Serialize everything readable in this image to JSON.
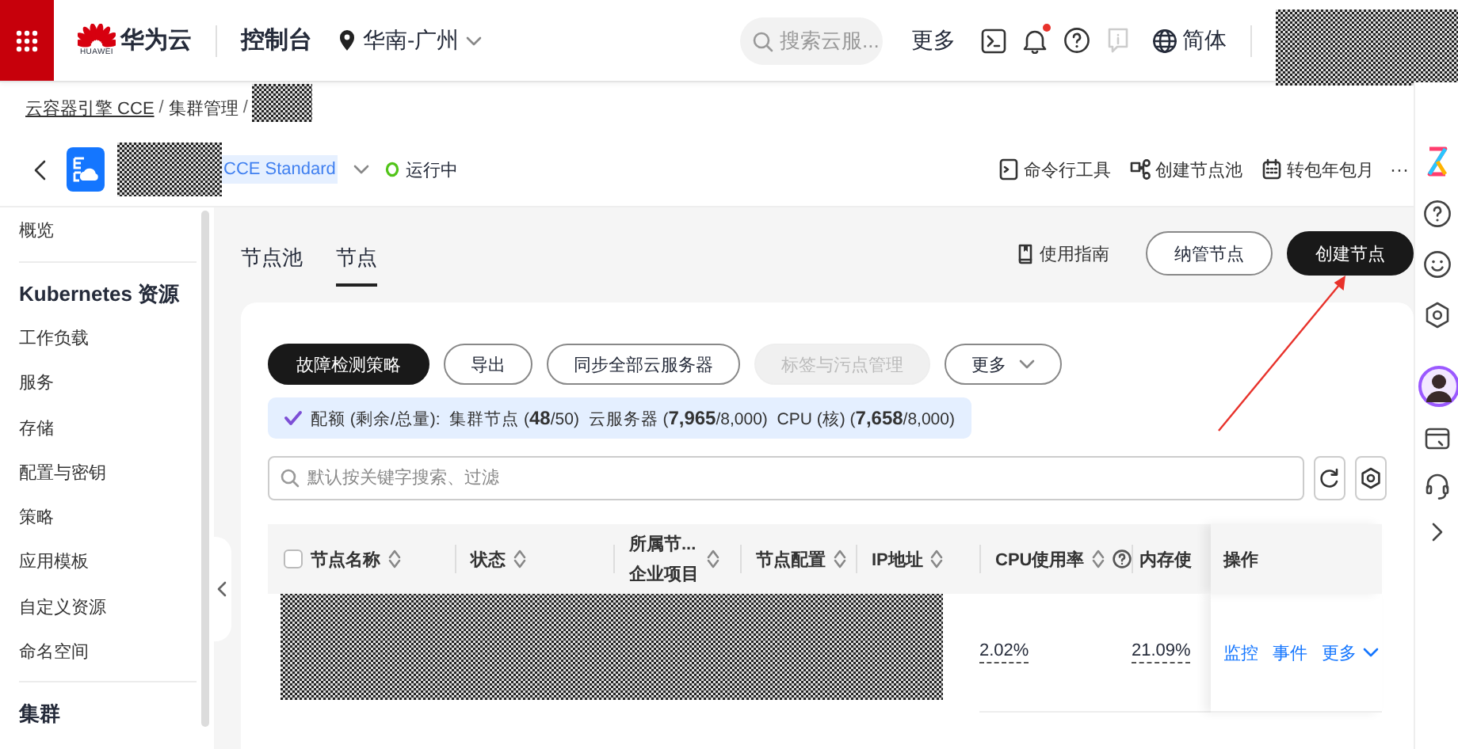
{
  "top_bar": {
    "brand": "华为云",
    "logo_caption": "HUAWEI",
    "console": "控制台",
    "region": "华南-广州",
    "search": {
      "placeholder": "搜索云服..."
    },
    "more": "更多",
    "notification_unread": true,
    "language": "简体"
  },
  "breadcrumb": {
    "separator": "/",
    "items": [
      {
        "label": "云容器引擎 CCE",
        "kind": "link"
      },
      {
        "label": "集群管理",
        "kind": "text"
      }
    ]
  },
  "cluster": {
    "edition": "CCE Standard",
    "status": "运行中"
  },
  "header_actions": [
    {
      "label": "命令行工具"
    },
    {
      "label": "创建节点池"
    },
    {
      "label": "转包年包月"
    }
  ],
  "more_actions": "···",
  "sidebar": {
    "items": [
      {
        "kind": "item",
        "label": "概览",
        "selected": false
      },
      {
        "kind": "divider"
      },
      {
        "kind": "heading",
        "label": "Kubernetes 资源"
      },
      {
        "kind": "item",
        "label": "工作负载",
        "selected": false
      },
      {
        "kind": "item",
        "label": "服务",
        "selected": false
      },
      {
        "kind": "item",
        "label": "存储",
        "selected": false
      },
      {
        "kind": "item",
        "label": "配置与密钥",
        "selected": false
      },
      {
        "kind": "item",
        "label": "策略",
        "selected": false
      },
      {
        "kind": "item",
        "label": "应用模板",
        "selected": false
      },
      {
        "kind": "item",
        "label": "自定义资源",
        "selected": false
      },
      {
        "kind": "item",
        "label": "命名空间",
        "selected": false
      },
      {
        "kind": "divider"
      },
      {
        "kind": "heading",
        "label": "集群"
      }
    ]
  },
  "tabs": [
    {
      "label": "节点池",
      "selected": false
    },
    {
      "label": "节点",
      "selected": true
    }
  ],
  "page_actions": {
    "guide": "使用指南",
    "buttons": [
      {
        "label": "纳管节点",
        "kind": "outline"
      },
      {
        "label": "创建节点",
        "kind": "primary"
      }
    ]
  },
  "toolbar": [
    {
      "label": "故障检测策略",
      "kind": "primary",
      "disabled": false
    },
    {
      "label": "导出",
      "kind": "outline",
      "disabled": false
    },
    {
      "label": "同步全部云服务器",
      "kind": "outline",
      "disabled": false
    },
    {
      "label": "标签与污点管理",
      "kind": "outline",
      "disabled": true
    },
    {
      "label": "更多",
      "kind": "dropdown",
      "disabled": false
    }
  ],
  "quota": "配额 (剩余/总量):  集群节点 (**48**/50)  云服务器 (**7,965**/8,000)  CPU (核) (**7,658**/8,000)",
  "filter": {
    "placeholder": "默认按关键字搜索、过滤"
  },
  "table": {
    "all_checked": false,
    "columns": [
      {
        "label": "节点名称",
        "sortable": true,
        "help": false
      },
      {
        "label": "状态",
        "sortable": true,
        "help": false
      },
      {
        "label": "所属节...",
        "sublabel": "企业项目",
        "sortable": true,
        "help": false
      },
      {
        "label": "节点配置",
        "sortable": true,
        "help": false
      },
      {
        "label": "IP地址",
        "sortable": true,
        "help": false
      },
      {
        "label": "CPU使用率",
        "sortable": true,
        "help": true
      },
      {
        "label": "内存使",
        "sortable": false,
        "help": false
      },
      {
        "label": "操作",
        "sortable": false,
        "help": false
      }
    ],
    "rows": [
      {
        "cpu": "2.02%",
        "memory": "21.09%",
        "actions": [
          {
            "label": "监控",
            "dropdown": false
          },
          {
            "label": "事件",
            "dropdown": false
          },
          {
            "label": "更多",
            "dropdown": true
          }
        ]
      }
    ]
  }
}
